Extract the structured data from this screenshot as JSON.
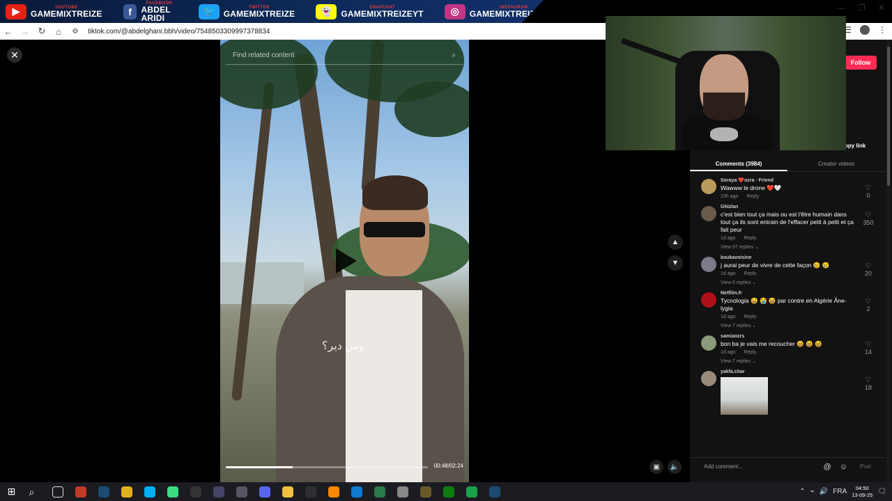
{
  "banner": [
    {
      "top": "YOUTUBE",
      "name": "GAMEMIXTREIZE",
      "icon": "youtube-icon",
      "color": "#e62117",
      "glyph": "▶"
    },
    {
      "top": "FACEBOOK",
      "name": "ABDEL ARIDI",
      "icon": "facebook-icon",
      "color": "#3b5998",
      "glyph": "f"
    },
    {
      "top": "TWITTER",
      "name": "GAMEMIXTREIZE",
      "icon": "twitter-icon",
      "color": "#1da1f2",
      "glyph": "🐦"
    },
    {
      "top": "SNAPCHAT",
      "name": "GAMEMIXTREIZEYT",
      "icon": "snapchat-icon",
      "color": "#fffc00",
      "glyph": "👻"
    },
    {
      "top": "INSTAGRAM",
      "name": "GAMEMIXTREIZEOFF",
      "icon": "instagram-icon",
      "color": "#c13584",
      "glyph": "◎"
    }
  ],
  "browser": {
    "url": "tiktok.com/@abdelghani.bbh/video/7548503309997378834"
  },
  "video": {
    "search_placeholder": "Find related content",
    "caption": "وس دير؟",
    "time": "00:48/02:24",
    "progress": 0.33
  },
  "panel": {
    "follow": "Follow",
    "copy_link": "opy link",
    "tabs": [
      "Comments (3984)",
      "Creator videos"
    ]
  },
  "comments": [
    {
      "user": "Soraya ❤️ozra · Friend",
      "text": "Wawww le drone ❤️🤍",
      "time": "23h ago",
      "reply": "Reply",
      "replies": "",
      "likes": "0",
      "avatar": "#b89a5a"
    },
    {
      "user": "Ghizlan",
      "text": "c'est bien tout ça mais ou est l'être humain dans tout ça ils sont entrain de l'effacer petit à petit et ça fait peur",
      "time": "1d ago",
      "reply": "Reply",
      "replies": "View 57 replies ⌄",
      "likes": "350",
      "avatar": "#6a5a4a"
    },
    {
      "user": "koukavoisine",
      "text": "j aurai peur de vivre de cette façon 😢 😢",
      "time": "1d ago",
      "reply": "Reply",
      "replies": "View 6 replies ⌄",
      "likes": "20",
      "avatar": "#7a7a8a"
    },
    {
      "user": "Netfilm.fr",
      "text": "Tycnologia 😄 😭 😆 par contre en Algérie Âne-lygia",
      "time": "1d ago",
      "reply": "Reply",
      "replies": "View 7 replies ⌄",
      "likes": "2",
      "avatar": "#b0101a"
    },
    {
      "user": "samiaozrs",
      "text": "bon ba je vais me recoucher 😆 😆 😆",
      "time": "1d ago",
      "reply": "Reply",
      "replies": "View 7 replies ⌄",
      "likes": "14",
      "avatar": "#8a9a7a"
    },
    {
      "user": "yakfa.char",
      "text": "",
      "time": "",
      "reply": "",
      "replies": "",
      "likes": "18",
      "avatar": "#9a8a7a"
    }
  ],
  "add_comment": {
    "placeholder": "Add comment...",
    "post": "Post"
  },
  "taskbar": {
    "lang": "FRA",
    "time": "04:50",
    "date": "13-09-25",
    "notif_count": "2",
    "apps": [
      {
        "icon": "search-icon",
        "color": "#1b1b22"
      },
      {
        "icon": "task-view-icon",
        "color": "#1b1b22"
      },
      {
        "icon": "recorder-icon",
        "color": "#c23a2a"
      },
      {
        "icon": "steam-icon",
        "color": "#1b4b72"
      },
      {
        "icon": "chrome-icon",
        "color": "#e0b020"
      },
      {
        "icon": "skype-icon",
        "color": "#00aff0"
      },
      {
        "icon": "android-icon",
        "color": "#3ddc84"
      },
      {
        "icon": "epic-icon",
        "color": "#333333"
      },
      {
        "icon": "app-icon",
        "color": "#444466"
      },
      {
        "icon": "app-icon",
        "color": "#555566"
      },
      {
        "icon": "discord-icon",
        "color": "#5865f2"
      },
      {
        "icon": "folder-icon",
        "color": "#f0c040"
      },
      {
        "icon": "obs-icon",
        "color": "#302e31"
      },
      {
        "icon": "vlc-icon",
        "color": "#ff8800"
      },
      {
        "icon": "edge-icon",
        "color": "#0f7acf"
      },
      {
        "icon": "app-icon",
        "color": "#2a7a4a"
      },
      {
        "icon": "app-icon",
        "color": "#888888"
      },
      {
        "icon": "app-icon",
        "color": "#6a5a2a"
      },
      {
        "icon": "xbox-icon",
        "color": "#107c10"
      },
      {
        "icon": "app-icon",
        "color": "#1aa34a"
      },
      {
        "icon": "steam-icon",
        "color": "#1b4b72"
      }
    ]
  }
}
